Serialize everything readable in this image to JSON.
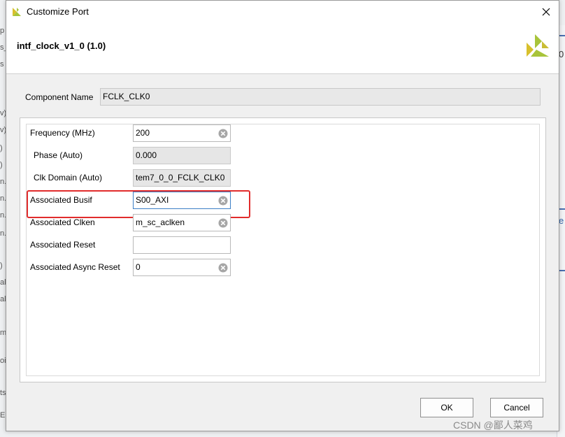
{
  "dialog": {
    "title": "Customize Port",
    "header_title": "intf_clock_v1_0 (1.0)"
  },
  "component": {
    "label": "Component Name",
    "value": "FCLK_CLK0"
  },
  "fields": {
    "frequency": {
      "label": "Frequency (MHz)",
      "value": "200"
    },
    "phase": {
      "label": "Phase (Auto)",
      "value": "0.000"
    },
    "clk_domain": {
      "label": "Clk Domain (Auto)",
      "value": "tem7_0_0_FCLK_CLK0"
    },
    "assoc_busif": {
      "label": "Associated Busif",
      "value": "S00_AXI"
    },
    "assoc_clken": {
      "label": "Associated Clken",
      "value": "m_sc_aclken"
    },
    "assoc_reset": {
      "label": "Associated Reset",
      "value": ""
    },
    "assoc_async_reset": {
      "label": "Associated Async Reset",
      "value": "0"
    }
  },
  "buttons": {
    "ok": "OK",
    "cancel": "Cancel"
  },
  "watermark": "CSDN @鄙人菜鸡",
  "colors": {
    "highlight": "#e12c2c",
    "focus_border": "#3c7fc6",
    "logo_green": "#a8c43a",
    "logo_yellow": "#d8c02c"
  }
}
